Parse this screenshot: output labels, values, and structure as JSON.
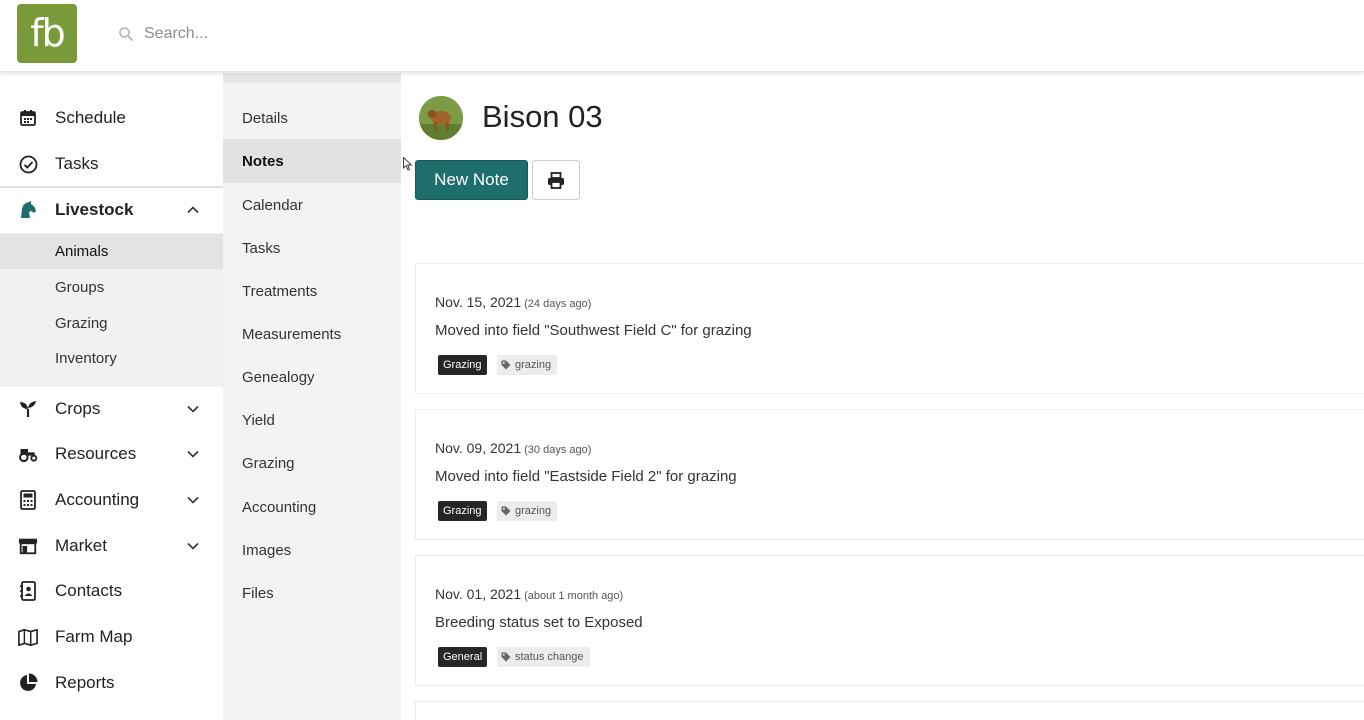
{
  "app": {
    "logo_text": "fb",
    "brand_color": "#7a9a3a",
    "accent_color": "#1e6e6e"
  },
  "search": {
    "placeholder": "Search..."
  },
  "sidebar": {
    "items": [
      {
        "label": "Schedule",
        "icon": "calendar-icon"
      },
      {
        "label": "Tasks",
        "icon": "check-circle-icon"
      },
      {
        "label": "Livestock",
        "icon": "horse-head-icon"
      },
      {
        "label": "Crops",
        "icon": "seedling-icon"
      },
      {
        "label": "Resources",
        "icon": "tractor-icon"
      },
      {
        "label": "Accounting",
        "icon": "calculator-icon"
      },
      {
        "label": "Market",
        "icon": "store-icon"
      },
      {
        "label": "Contacts",
        "icon": "address-book-icon"
      },
      {
        "label": "Farm Map",
        "icon": "map-icon"
      },
      {
        "label": "Reports",
        "icon": "pie-chart-icon"
      }
    ],
    "livestock_sub": [
      "Animals",
      "Groups",
      "Grazing",
      "Inventory"
    ]
  },
  "subnav": {
    "items": [
      "Details",
      "Notes",
      "Calendar",
      "Tasks",
      "Treatments",
      "Measurements",
      "Genealogy",
      "Yield",
      "Grazing",
      "Accounting",
      "Images",
      "Files"
    ],
    "active": "Notes"
  },
  "main": {
    "title": "Bison 03",
    "new_note_label": "New Note",
    "print_icon": "print-icon"
  },
  "notes": [
    {
      "date": "Nov. 15, 2021",
      "ago": "(24 days ago)",
      "text": "Moved into field \"Southwest Field C\" for grazing",
      "category": "Grazing",
      "tag": "grazing"
    },
    {
      "date": "Nov. 09, 2021",
      "ago": "(30 days ago)",
      "text": "Moved into field \"Eastside Field 2\" for grazing",
      "category": "Grazing",
      "tag": "grazing"
    },
    {
      "date": "Nov. 01, 2021",
      "ago": "(about 1 month ago)",
      "text": "Breeding status set to Exposed",
      "category": "General",
      "tag": "status change"
    }
  ]
}
